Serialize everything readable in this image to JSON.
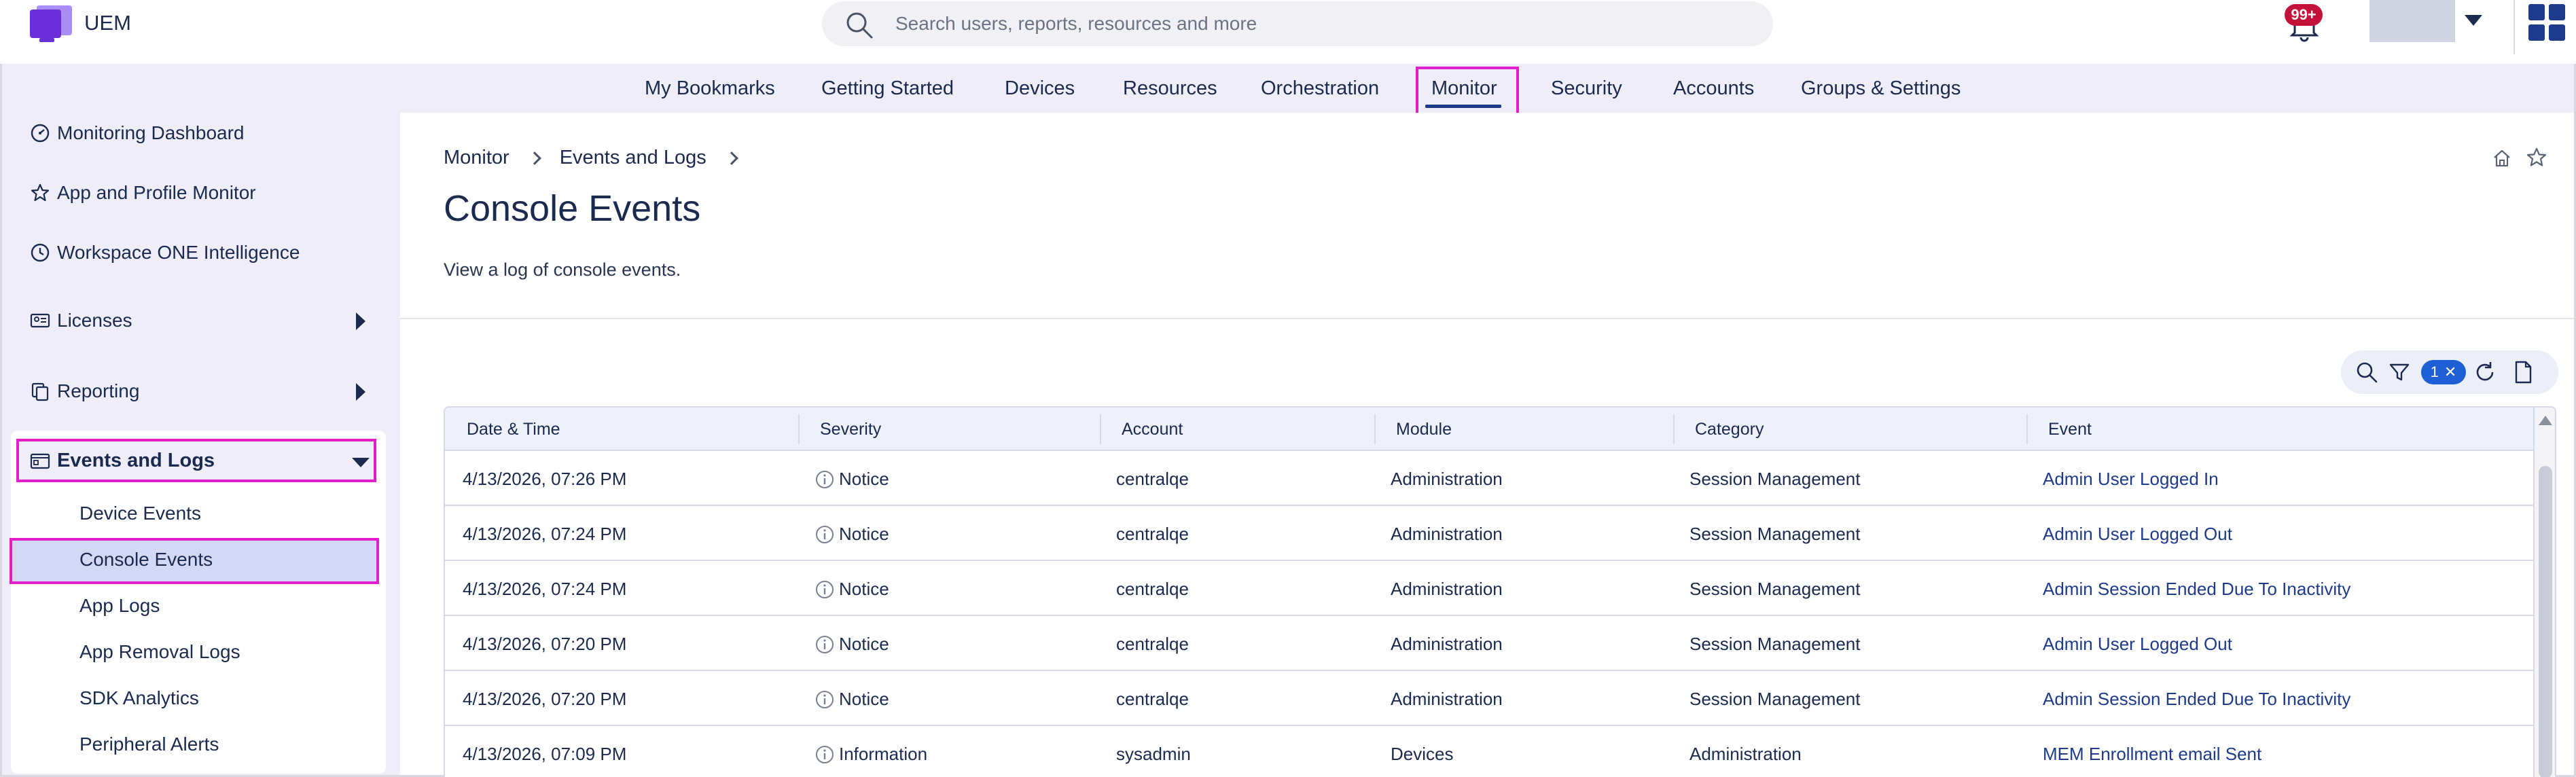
{
  "app": {
    "name": "UEM"
  },
  "search": {
    "placeholder": "Search users, reports, resources and more"
  },
  "notifications": {
    "badge": "99+"
  },
  "colors": {
    "accent": "#1e3a8a",
    "highlight": "#e11dcc",
    "badge": "#c4113a",
    "nav_bg": "#eeedf8"
  },
  "nav": {
    "items": [
      {
        "label": "My Bookmarks"
      },
      {
        "label": "Getting Started"
      },
      {
        "label": "Devices"
      },
      {
        "label": "Resources"
      },
      {
        "label": "Orchestration"
      },
      {
        "label": "Monitor"
      },
      {
        "label": "Security"
      },
      {
        "label": "Accounts"
      },
      {
        "label": "Groups & Settings"
      }
    ],
    "active": "Monitor"
  },
  "sidebar": {
    "items": [
      {
        "label": "Monitoring Dashboard",
        "icon": "gauge-icon"
      },
      {
        "label": "App and Profile Monitor",
        "icon": "star-icon"
      },
      {
        "label": "Workspace ONE Intelligence",
        "icon": "clock-icon"
      },
      {
        "label": "Licenses",
        "icon": "id-card-icon"
      },
      {
        "label": "Reporting",
        "icon": "copy-icon"
      }
    ],
    "events_group": {
      "label": "Events and Logs",
      "icon": "window-icon",
      "children": [
        {
          "label": "Device Events"
        },
        {
          "label": "Console Events"
        },
        {
          "label": "App Logs"
        },
        {
          "label": "App Removal Logs"
        },
        {
          "label": "SDK Analytics"
        },
        {
          "label": "Peripheral Alerts"
        }
      ],
      "selected": "Console Events"
    }
  },
  "breadcrumb": [
    {
      "label": "Monitor"
    },
    {
      "label": "Events and Logs"
    }
  ],
  "page": {
    "title": "Console Events",
    "description": "View a log of console events."
  },
  "toolbar": {
    "filter_count": "1"
  },
  "table": {
    "columns": [
      "Date & Time",
      "Severity",
      "Account",
      "Module",
      "Category",
      "Event"
    ],
    "rows": [
      {
        "datetime": "4/13/2026, 07:26 PM",
        "severity": "Notice",
        "account": "centralqe",
        "module": "Administration",
        "category": "Session Management",
        "event": "Admin User Logged In"
      },
      {
        "datetime": "4/13/2026, 07:24 PM",
        "severity": "Notice",
        "account": "centralqe",
        "module": "Administration",
        "category": "Session Management",
        "event": "Admin User Logged Out"
      },
      {
        "datetime": "4/13/2026, 07:24 PM",
        "severity": "Notice",
        "account": "centralqe",
        "module": "Administration",
        "category": "Session Management",
        "event": "Admin Session Ended Due To Inactivity"
      },
      {
        "datetime": "4/13/2026, 07:20 PM",
        "severity": "Notice",
        "account": "centralqe",
        "module": "Administration",
        "category": "Session Management",
        "event": "Admin User Logged Out"
      },
      {
        "datetime": "4/13/2026, 07:20 PM",
        "severity": "Notice",
        "account": "centralqe",
        "module": "Administration",
        "category": "Session Management",
        "event": "Admin Session Ended Due To Inactivity"
      },
      {
        "datetime": "4/13/2026, 07:09 PM",
        "severity": "Information",
        "account": "sysadmin",
        "module": "Devices",
        "category": "Administration",
        "event": "MEM Enrollment email Sent"
      }
    ]
  }
}
